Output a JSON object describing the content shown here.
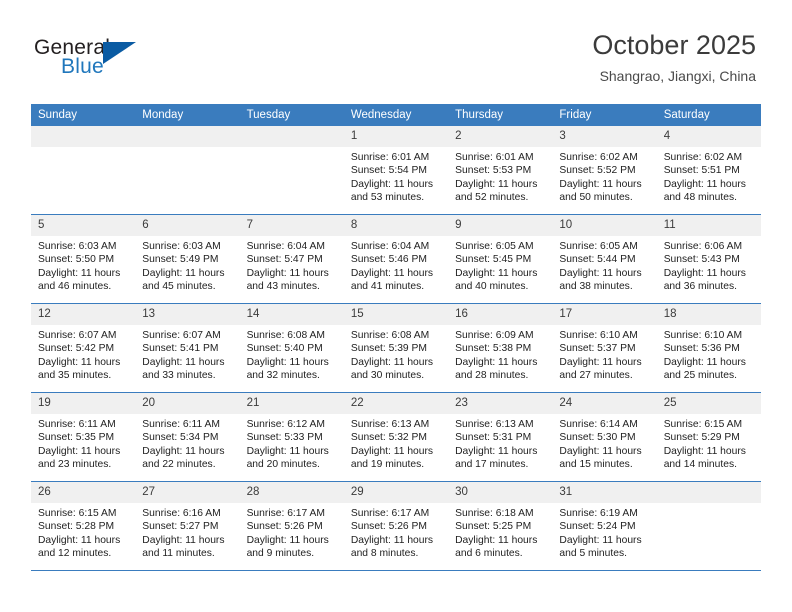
{
  "brand": {
    "name_part1": "General",
    "name_part2": "Blue",
    "triangle_color": "#0a5ba3",
    "accent_color": "#2077bc"
  },
  "header": {
    "title": "October 2025",
    "location": "Shangrao, Jiangxi, China"
  },
  "theme": {
    "header_row_bg": "#3a7cbe",
    "daynum_bg": "#f0f0f0",
    "row_border": "#3a7cbe"
  },
  "weekdays": [
    "Sunday",
    "Monday",
    "Tuesday",
    "Wednesday",
    "Thursday",
    "Friday",
    "Saturday"
  ],
  "weeks": [
    [
      {
        "day": "",
        "sunrise": "",
        "sunset": "",
        "daylight1": "",
        "daylight2": ""
      },
      {
        "day": "",
        "sunrise": "",
        "sunset": "",
        "daylight1": "",
        "daylight2": ""
      },
      {
        "day": "",
        "sunrise": "",
        "sunset": "",
        "daylight1": "",
        "daylight2": ""
      },
      {
        "day": "1",
        "sunrise": "Sunrise: 6:01 AM",
        "sunset": "Sunset: 5:54 PM",
        "daylight1": "Daylight: 11 hours",
        "daylight2": "and 53 minutes."
      },
      {
        "day": "2",
        "sunrise": "Sunrise: 6:01 AM",
        "sunset": "Sunset: 5:53 PM",
        "daylight1": "Daylight: 11 hours",
        "daylight2": "and 52 minutes."
      },
      {
        "day": "3",
        "sunrise": "Sunrise: 6:02 AM",
        "sunset": "Sunset: 5:52 PM",
        "daylight1": "Daylight: 11 hours",
        "daylight2": "and 50 minutes."
      },
      {
        "day": "4",
        "sunrise": "Sunrise: 6:02 AM",
        "sunset": "Sunset: 5:51 PM",
        "daylight1": "Daylight: 11 hours",
        "daylight2": "and 48 minutes."
      }
    ],
    [
      {
        "day": "5",
        "sunrise": "Sunrise: 6:03 AM",
        "sunset": "Sunset: 5:50 PM",
        "daylight1": "Daylight: 11 hours",
        "daylight2": "and 46 minutes."
      },
      {
        "day": "6",
        "sunrise": "Sunrise: 6:03 AM",
        "sunset": "Sunset: 5:49 PM",
        "daylight1": "Daylight: 11 hours",
        "daylight2": "and 45 minutes."
      },
      {
        "day": "7",
        "sunrise": "Sunrise: 6:04 AM",
        "sunset": "Sunset: 5:47 PM",
        "daylight1": "Daylight: 11 hours",
        "daylight2": "and 43 minutes."
      },
      {
        "day": "8",
        "sunrise": "Sunrise: 6:04 AM",
        "sunset": "Sunset: 5:46 PM",
        "daylight1": "Daylight: 11 hours",
        "daylight2": "and 41 minutes."
      },
      {
        "day": "9",
        "sunrise": "Sunrise: 6:05 AM",
        "sunset": "Sunset: 5:45 PM",
        "daylight1": "Daylight: 11 hours",
        "daylight2": "and 40 minutes."
      },
      {
        "day": "10",
        "sunrise": "Sunrise: 6:05 AM",
        "sunset": "Sunset: 5:44 PM",
        "daylight1": "Daylight: 11 hours",
        "daylight2": "and 38 minutes."
      },
      {
        "day": "11",
        "sunrise": "Sunrise: 6:06 AM",
        "sunset": "Sunset: 5:43 PM",
        "daylight1": "Daylight: 11 hours",
        "daylight2": "and 36 minutes."
      }
    ],
    [
      {
        "day": "12",
        "sunrise": "Sunrise: 6:07 AM",
        "sunset": "Sunset: 5:42 PM",
        "daylight1": "Daylight: 11 hours",
        "daylight2": "and 35 minutes."
      },
      {
        "day": "13",
        "sunrise": "Sunrise: 6:07 AM",
        "sunset": "Sunset: 5:41 PM",
        "daylight1": "Daylight: 11 hours",
        "daylight2": "and 33 minutes."
      },
      {
        "day": "14",
        "sunrise": "Sunrise: 6:08 AM",
        "sunset": "Sunset: 5:40 PM",
        "daylight1": "Daylight: 11 hours",
        "daylight2": "and 32 minutes."
      },
      {
        "day": "15",
        "sunrise": "Sunrise: 6:08 AM",
        "sunset": "Sunset: 5:39 PM",
        "daylight1": "Daylight: 11 hours",
        "daylight2": "and 30 minutes."
      },
      {
        "day": "16",
        "sunrise": "Sunrise: 6:09 AM",
        "sunset": "Sunset: 5:38 PM",
        "daylight1": "Daylight: 11 hours",
        "daylight2": "and 28 minutes."
      },
      {
        "day": "17",
        "sunrise": "Sunrise: 6:10 AM",
        "sunset": "Sunset: 5:37 PM",
        "daylight1": "Daylight: 11 hours",
        "daylight2": "and 27 minutes."
      },
      {
        "day": "18",
        "sunrise": "Sunrise: 6:10 AM",
        "sunset": "Sunset: 5:36 PM",
        "daylight1": "Daylight: 11 hours",
        "daylight2": "and 25 minutes."
      }
    ],
    [
      {
        "day": "19",
        "sunrise": "Sunrise: 6:11 AM",
        "sunset": "Sunset: 5:35 PM",
        "daylight1": "Daylight: 11 hours",
        "daylight2": "and 23 minutes."
      },
      {
        "day": "20",
        "sunrise": "Sunrise: 6:11 AM",
        "sunset": "Sunset: 5:34 PM",
        "daylight1": "Daylight: 11 hours",
        "daylight2": "and 22 minutes."
      },
      {
        "day": "21",
        "sunrise": "Sunrise: 6:12 AM",
        "sunset": "Sunset: 5:33 PM",
        "daylight1": "Daylight: 11 hours",
        "daylight2": "and 20 minutes."
      },
      {
        "day": "22",
        "sunrise": "Sunrise: 6:13 AM",
        "sunset": "Sunset: 5:32 PM",
        "daylight1": "Daylight: 11 hours",
        "daylight2": "and 19 minutes."
      },
      {
        "day": "23",
        "sunrise": "Sunrise: 6:13 AM",
        "sunset": "Sunset: 5:31 PM",
        "daylight1": "Daylight: 11 hours",
        "daylight2": "and 17 minutes."
      },
      {
        "day": "24",
        "sunrise": "Sunrise: 6:14 AM",
        "sunset": "Sunset: 5:30 PM",
        "daylight1": "Daylight: 11 hours",
        "daylight2": "and 15 minutes."
      },
      {
        "day": "25",
        "sunrise": "Sunrise: 6:15 AM",
        "sunset": "Sunset: 5:29 PM",
        "daylight1": "Daylight: 11 hours",
        "daylight2": "and 14 minutes."
      }
    ],
    [
      {
        "day": "26",
        "sunrise": "Sunrise: 6:15 AM",
        "sunset": "Sunset: 5:28 PM",
        "daylight1": "Daylight: 11 hours",
        "daylight2": "and 12 minutes."
      },
      {
        "day": "27",
        "sunrise": "Sunrise: 6:16 AM",
        "sunset": "Sunset: 5:27 PM",
        "daylight1": "Daylight: 11 hours",
        "daylight2": "and 11 minutes."
      },
      {
        "day": "28",
        "sunrise": "Sunrise: 6:17 AM",
        "sunset": "Sunset: 5:26 PM",
        "daylight1": "Daylight: 11 hours",
        "daylight2": "and 9 minutes."
      },
      {
        "day": "29",
        "sunrise": "Sunrise: 6:17 AM",
        "sunset": "Sunset: 5:26 PM",
        "daylight1": "Daylight: 11 hours",
        "daylight2": "and 8 minutes."
      },
      {
        "day": "30",
        "sunrise": "Sunrise: 6:18 AM",
        "sunset": "Sunset: 5:25 PM",
        "daylight1": "Daylight: 11 hours",
        "daylight2": "and 6 minutes."
      },
      {
        "day": "31",
        "sunrise": "Sunrise: 6:19 AM",
        "sunset": "Sunset: 5:24 PM",
        "daylight1": "Daylight: 11 hours",
        "daylight2": "and 5 minutes."
      },
      {
        "day": "",
        "sunrise": "",
        "sunset": "",
        "daylight1": "",
        "daylight2": ""
      }
    ]
  ]
}
